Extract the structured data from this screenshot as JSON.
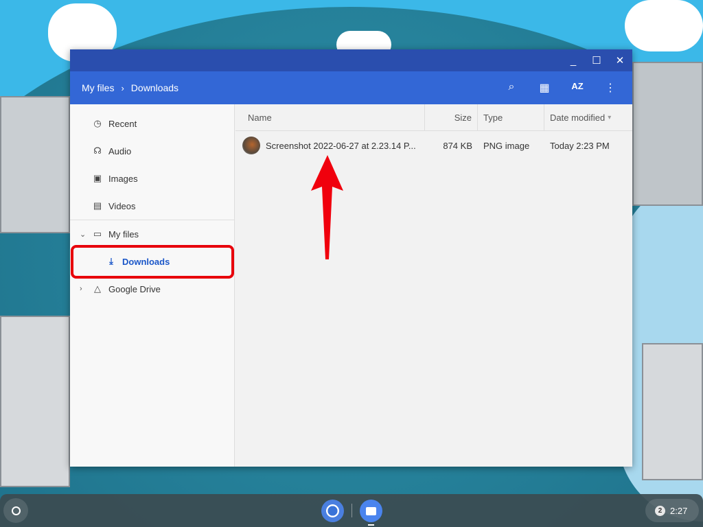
{
  "window": {
    "controls": {
      "minimize": "_",
      "maximize": "☐",
      "close": "✕"
    }
  },
  "header": {
    "breadcrumb": [
      "My files",
      "Downloads"
    ],
    "separator": "›"
  },
  "toolbar": {
    "search": "⌕",
    "grid": "▦",
    "sort": "AZ",
    "more": "⋮"
  },
  "sidebar": {
    "items": [
      {
        "label": "Recent",
        "icon": "clock-icon",
        "glyph": "◷"
      },
      {
        "label": "Audio",
        "icon": "headphones-icon",
        "glyph": "☊"
      },
      {
        "label": "Images",
        "icon": "image-icon",
        "glyph": "▣"
      },
      {
        "label": "Videos",
        "icon": "film-icon",
        "glyph": "▤"
      },
      {
        "label": "My files",
        "icon": "laptop-icon",
        "glyph": "▭"
      },
      {
        "label": "Downloads",
        "icon": "download-icon",
        "glyph": "⤓"
      },
      {
        "label": "Google Drive",
        "icon": "drive-icon",
        "glyph": "△"
      }
    ],
    "expand_open": "⌄",
    "expand_closed": "›"
  },
  "columns": {
    "name": "Name",
    "size": "Size",
    "type": "Type",
    "date": "Date modified",
    "sort_arrow": "▾"
  },
  "files": [
    {
      "name": "Screenshot 2022-06-27 at 2.23.14 P...",
      "size": "874 KB",
      "type": "PNG image",
      "date": "Today 2:23 PM"
    }
  ],
  "shelf": {
    "notifications": "2",
    "time": "2:27"
  },
  "colors": {
    "header": "#3367d6",
    "titlebar": "#2a4eae",
    "highlight": "#e8000b",
    "selected_text": "#1a56c8"
  }
}
